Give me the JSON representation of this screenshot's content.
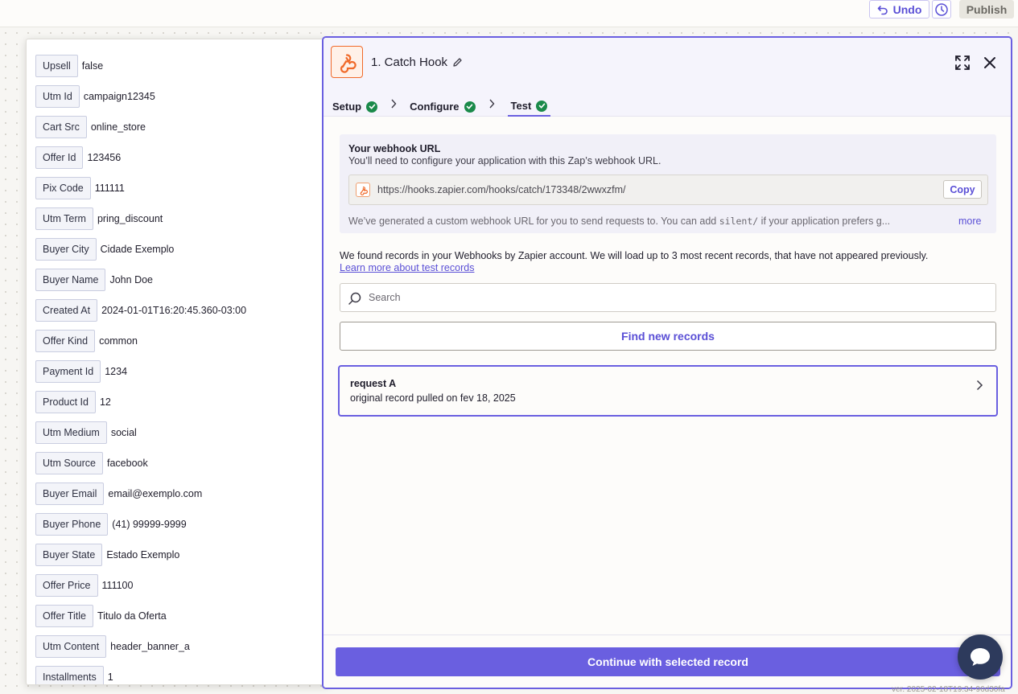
{
  "topbar": {
    "undo_label": "Undo",
    "publish_label": "Publish"
  },
  "fields": [
    {
      "label": "Upsell",
      "value": "false"
    },
    {
      "label": "Utm Id",
      "value": "campaign12345"
    },
    {
      "label": "Cart Src",
      "value": "online_store"
    },
    {
      "label": "Offer Id",
      "value": "123456"
    },
    {
      "label": "Pix Code",
      "value": "111111"
    },
    {
      "label": "Utm Term",
      "value": "pring_discount"
    },
    {
      "label": "Buyer City",
      "value": "Cidade Exemplo"
    },
    {
      "label": "Buyer Name",
      "value": "John Doe"
    },
    {
      "label": "Created At",
      "value": "2024-01-01T16:20:45.360-03:00"
    },
    {
      "label": "Offer Kind",
      "value": "common"
    },
    {
      "label": "Payment Id",
      "value": "1234"
    },
    {
      "label": "Product Id",
      "value": "12"
    },
    {
      "label": "Utm Medium",
      "value": "social"
    },
    {
      "label": "Utm Source",
      "value": "facebook"
    },
    {
      "label": "Buyer Email",
      "value": "email@exemplo.com"
    },
    {
      "label": "Buyer Phone",
      "value": "(41) 99999-9999"
    },
    {
      "label": "Buyer State",
      "value": "Estado Exemplo"
    },
    {
      "label": "Offer Price",
      "value": "111100"
    },
    {
      "label": "Offer Title",
      "value": "Titulo da Oferta"
    },
    {
      "label": "Utm Content",
      "value": "header_banner_a"
    },
    {
      "label": "Installments",
      "value": "1"
    }
  ],
  "step": {
    "title": "1. Catch Hook",
    "tabs": [
      {
        "label": "Setup"
      },
      {
        "label": "Configure"
      },
      {
        "label": "Test"
      }
    ]
  },
  "webhook": {
    "title": "Your webhook URL",
    "subtitle": "You’ll need to configure your application with this Zap’s webhook URL.",
    "url": "https://hooks.zapier.com/hooks/catch/173348/2wwxzfm/",
    "copy_label": "Copy",
    "note_before": "We’ve generated a custom webhook URL for you to send requests to. You can add ",
    "note_code": "silent/",
    "note_after": " if your application prefers g...",
    "more_label": "more"
  },
  "records": {
    "found_text": "We found records in your Webhooks by Zapier account. We will load up to 3 most recent records, that have not appeared previously.",
    "learn_link": "Learn more about test records",
    "search_placeholder": "Search",
    "find_button": "Find new records",
    "items": [
      {
        "title": "request A",
        "subtitle": "original record pulled on fev 18, 2025"
      }
    ]
  },
  "footer": {
    "continue_label": "Continue with selected record"
  },
  "version": "ver. 2025-02-18T19:34-96d30fa"
}
